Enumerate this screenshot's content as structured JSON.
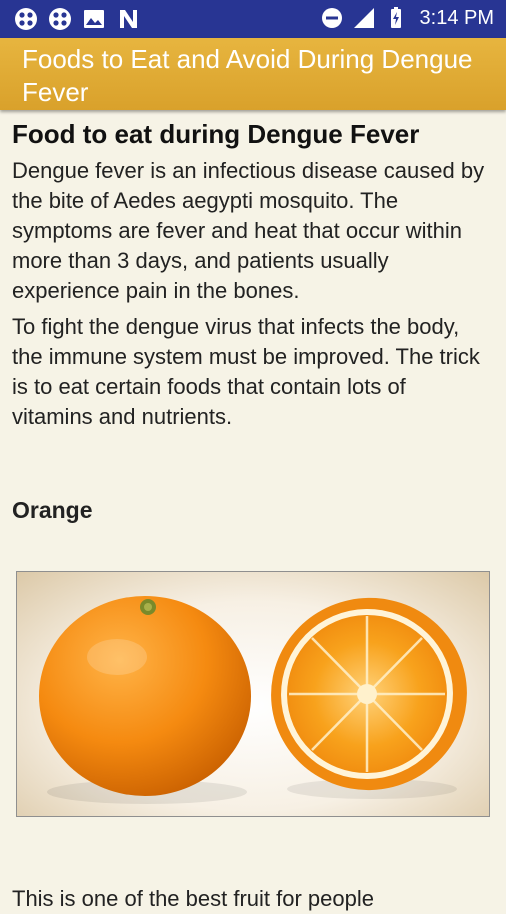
{
  "status_bar": {
    "time": "3:14 PM",
    "left_icons": [
      "app-grid-icon",
      "app-grid-icon",
      "image-icon",
      "n-notification-icon"
    ],
    "right_icons": [
      "do-not-disturb-icon",
      "signal-icon",
      "battery-icon"
    ]
  },
  "app_bar": {
    "title": "Foods to Eat and Avoid During Dengue Fever",
    "color": "#e0ab35"
  },
  "article": {
    "heading": "Food to eat during Dengue Fever",
    "paragraph1": "Dengue fever is an infectious disease caused by the bite of Aedes aegypti mosquito. The symptoms are fever and heat that occur within more than 3 days, and patients usually experience pain in the bones.",
    "paragraph2": "To fight the dengue virus that infects the body, the immune system must be improved. The trick is to eat certain foods that contain lots of vitamins and nutrients.",
    "food_title": "Orange",
    "food_image": "orange-fruit-image",
    "food_text": "This is one of the best fruit for people"
  }
}
